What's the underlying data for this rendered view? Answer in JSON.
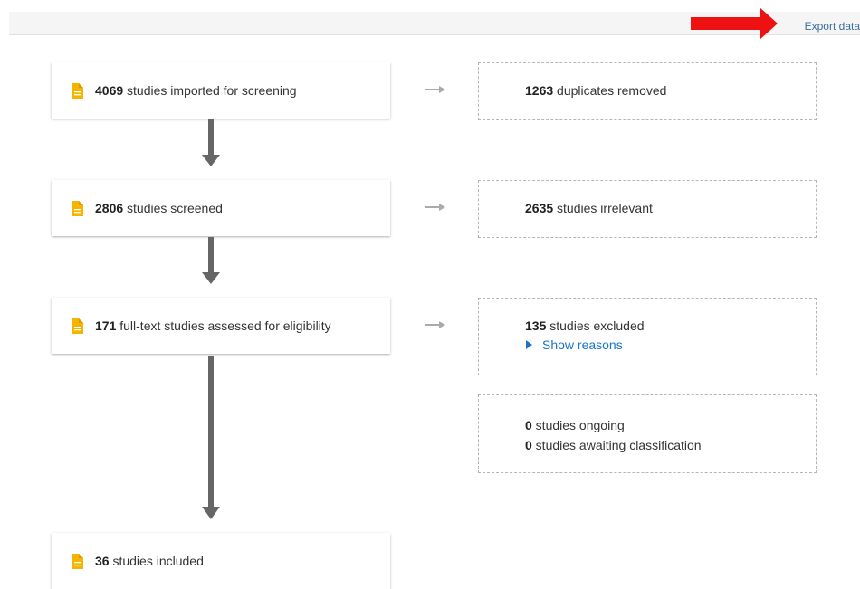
{
  "toolbar": {
    "export_label": "Export data"
  },
  "flow": {
    "imported": {
      "count": "4069",
      "text": " studies imported for screening"
    },
    "screened": {
      "count": "2806",
      "text": " studies screened"
    },
    "fulltext": {
      "count": "171",
      "text": " full-text studies assessed for eligibility"
    },
    "included": {
      "count": "36",
      "text": " studies included"
    }
  },
  "side": {
    "duplicates": {
      "count": "1263",
      "text": " duplicates removed"
    },
    "irrelevant": {
      "count": "2635",
      "text": " studies irrelevant"
    },
    "excluded": {
      "count": "135",
      "text": " studies excluded",
      "show_reasons": "Show reasons"
    },
    "other": {
      "ongoing_count": "0",
      "ongoing_text": " studies ongoing",
      "awaiting_count": "0",
      "awaiting_text": " studies awaiting classification"
    }
  },
  "colors": {
    "doc_icon": "#f5b400",
    "link": "#1a73c8",
    "annotation_arrow": "#ee1111",
    "flow_arrow": "#666666"
  }
}
